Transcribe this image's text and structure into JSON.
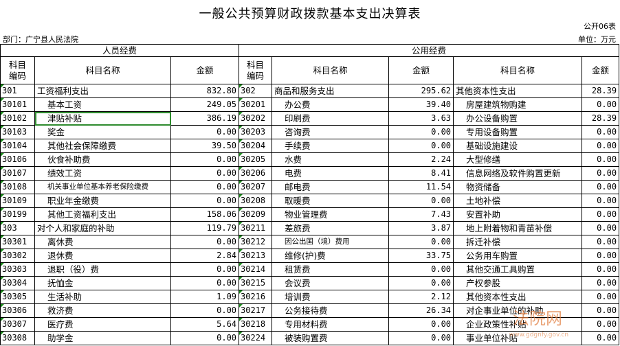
{
  "title": "一般公共预算财政拨款基本支出决算表",
  "form_no": "公开06表",
  "department": "部门：广宁县人民法院",
  "unit": "单位：万元",
  "group_headers": {
    "personnel": "人员经费",
    "public": "公用经费"
  },
  "col_headers": {
    "code": "科目\n编码",
    "name": "科目名称",
    "amount": "金额"
  },
  "rows": [
    {
      "c1": "301",
      "n1": "工资福利支出",
      "a1": "832.80",
      "c2": "302",
      "n2": "商品和服务支出",
      "a2": "295.62",
      "n3": "其他资本性支出",
      "a3": "28.39"
    },
    {
      "c1": "30101",
      "n1": "基本工资",
      "a1": "249.05",
      "c2": "30201",
      "n2": "办公费",
      "a2": "39.40",
      "n3": "房屋建筑物购建",
      "a3": "0.00"
    },
    {
      "c1": "30102",
      "n1": "津贴补贴",
      "a1": "386.19",
      "c2": "30202",
      "n2": "印刷费",
      "a2": "3.63",
      "n3": "办公设备购置",
      "a3": "28.39"
    },
    {
      "c1": "30103",
      "n1": "奖金",
      "a1": "0.00",
      "c2": "30203",
      "n2": "咨询费",
      "a2": "0.00",
      "n3": "专用设备购置",
      "a3": "0.00"
    },
    {
      "c1": "30104",
      "n1": "其他社会保障缴费",
      "a1": "39.50",
      "c2": "30204",
      "n2": "手续费",
      "a2": "0.00",
      "n3": "基础设施建设",
      "a3": "0.00"
    },
    {
      "c1": "30106",
      "n1": "伙食补助费",
      "a1": "0.00",
      "c2": "30205",
      "n2": "水费",
      "a2": "2.24",
      "n3": "大型修缮",
      "a3": "0.00"
    },
    {
      "c1": "30107",
      "n1": "绩效工资",
      "a1": "0.00",
      "c2": "30206",
      "n2": "电费",
      "a2": "8.41",
      "n3": "信息网络及软件购置更新",
      "a3": "0.00"
    },
    {
      "c1": "30108",
      "n1": "机关事业单位基本养老保险缴费",
      "a1": "0.00",
      "c2": "30207",
      "n2": "邮电费",
      "a2": "11.54",
      "n3": "物资储备",
      "a3": "0.00"
    },
    {
      "c1": "30109",
      "n1": "职业年金缴费",
      "a1": "0.00",
      "c2": "30208",
      "n2": "取暖费",
      "a2": "0.00",
      "n3": "土地补偿",
      "a3": "0.00"
    },
    {
      "c1": "30199",
      "n1": "其他工资福利支出",
      "a1": "158.06",
      "c2": "30209",
      "n2": "物业管理费",
      "a2": "7.43",
      "n3": "安置补助",
      "a3": "0.00"
    },
    {
      "c1": "303",
      "n1": "对个人和家庭的补助",
      "a1": "119.79",
      "c2": "30211",
      "n2": "差旅费",
      "a2": "3.87",
      "n3": "地上附着物和青苗补偿",
      "a3": "0.00"
    },
    {
      "c1": "30301",
      "n1": "离休费",
      "a1": "0.00",
      "c2": "30212",
      "n2": "因公出国（境）费用",
      "a2": "0.00",
      "n3": "拆迁补偿",
      "a3": "0.00"
    },
    {
      "c1": "30302",
      "n1": "退休费",
      "a1": "2.84",
      "c2": "30213",
      "n2": "维修(护)费",
      "a2": "33.75",
      "n3": "公务用车购置",
      "a3": "0.00"
    },
    {
      "c1": "30303",
      "n1": "退职（役）费",
      "a1": "0.00",
      "c2": "30214",
      "n2": "租赁费",
      "a2": "0.00",
      "n3": "其他交通工具购置",
      "a3": "0.00"
    },
    {
      "c1": "30304",
      "n1": "抚恤金",
      "a1": "0.00",
      "c2": "30215",
      "n2": "会议费",
      "a2": "0.00",
      "n3": "产权参股",
      "a3": "0.00"
    },
    {
      "c1": "30305",
      "n1": "生活补助",
      "a1": "1.09",
      "c2": "30216",
      "n2": "培训费",
      "a2": "2.12",
      "n3": "其他资本性支出",
      "a3": "0.00"
    },
    {
      "c1": "30306",
      "n1": "救济费",
      "a1": "0.00",
      "c2": "30217",
      "n2": "公务接待费",
      "a2": "26.34",
      "n3": "对企事业单位的补助",
      "a3": "0.00"
    },
    {
      "c1": "30307",
      "n1": "医疗费",
      "a1": "5.64",
      "c2": "30218",
      "n2": "专用材料费",
      "a2": "0.00",
      "n3": "企业政策性补贴",
      "a3": "0.00"
    },
    {
      "c1": "30308",
      "n1": "助学金",
      "a1": "0.00",
      "c2": "30224",
      "n2": "被装购置费",
      "a2": "0.00",
      "n3": "事业单位补贴",
      "a3": "0.00"
    }
  ],
  "watermark": {
    "text": "法院网",
    "sub": "www.gdgnfy.gov.cn",
    "color": "#e07a3a"
  }
}
